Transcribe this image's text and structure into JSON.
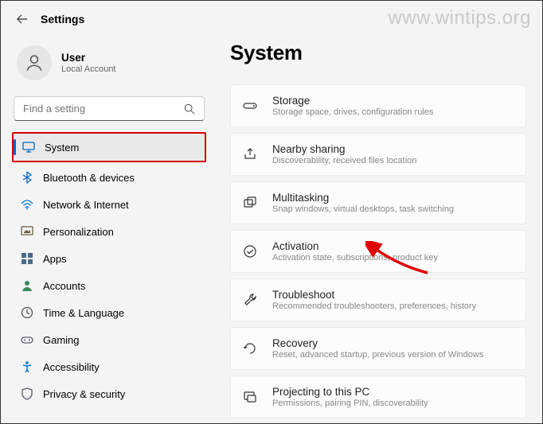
{
  "watermark": "www.wintips.org",
  "header": {
    "title": "Settings"
  },
  "user": {
    "name": "User",
    "sub": "Local Account"
  },
  "search": {
    "placeholder": "Find a setting"
  },
  "nav": {
    "system": "System",
    "bluetooth": "Bluetooth & devices",
    "network": "Network & Internet",
    "personalization": "Personalization",
    "apps": "Apps",
    "accounts": "Accounts",
    "time": "Time & Language",
    "gaming": "Gaming",
    "accessibility": "Accessibility",
    "privacy": "Privacy & security"
  },
  "page": {
    "title": "System"
  },
  "cards": {
    "storage": {
      "title": "Storage",
      "sub": "Storage space, drives, configuration rules"
    },
    "nearby": {
      "title": "Nearby sharing",
      "sub": "Discoverability, received files location"
    },
    "multitask": {
      "title": "Multitasking",
      "sub": "Snap windows, virtual desktops, task switching"
    },
    "activation": {
      "title": "Activation",
      "sub": "Activation state, subscriptions, product key"
    },
    "troubleshoot": {
      "title": "Troubleshoot",
      "sub": "Recommended troubleshooters, preferences, history"
    },
    "recovery": {
      "title": "Recovery",
      "sub": "Reset, advanced startup, previous version of Windows"
    },
    "projecting": {
      "title": "Projecting to this PC",
      "sub": "Permissions, pairing PIN, discoverability"
    }
  }
}
